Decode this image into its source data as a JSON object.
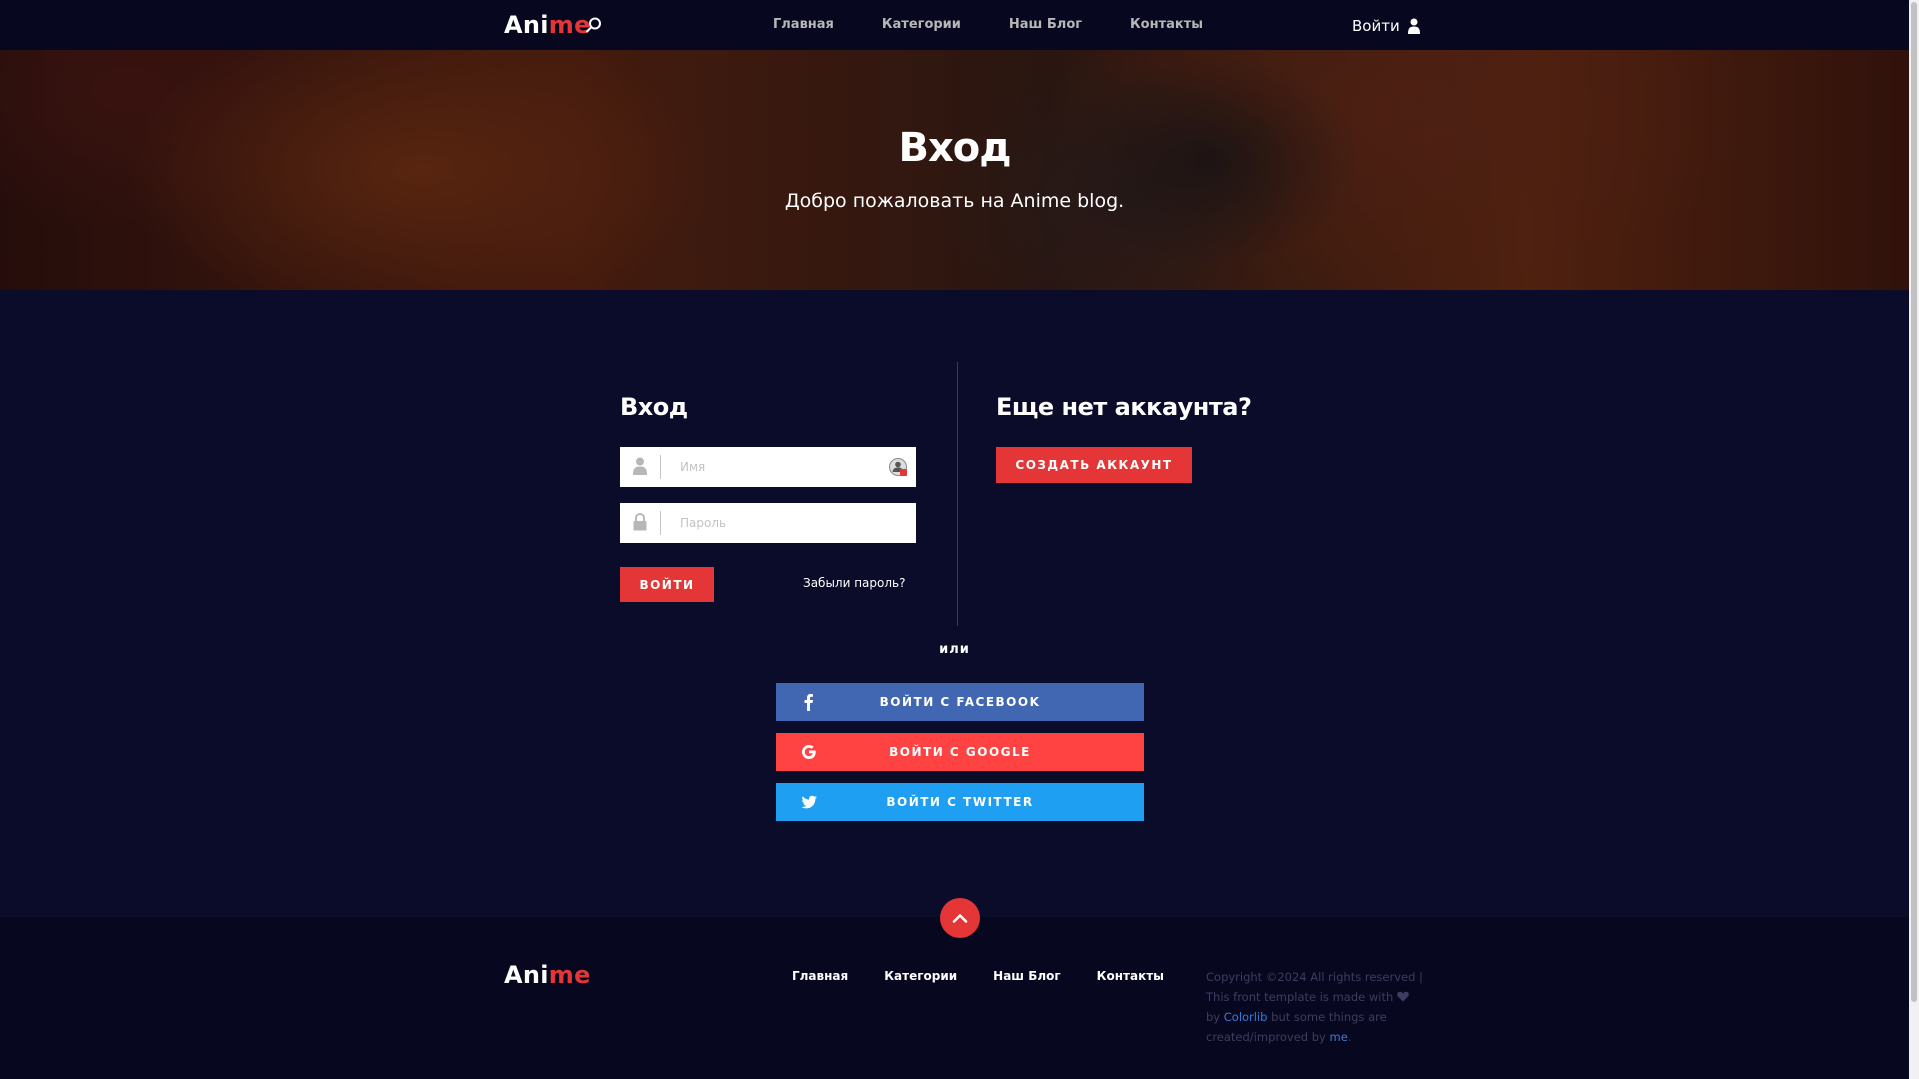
{
  "header": {
    "logo_part1": "Ani",
    "logo_part2": "me",
    "nav": [
      "Главная",
      "Категории",
      "Наш Блог",
      "Контакты"
    ],
    "login_label": "Войти"
  },
  "hero": {
    "title": "Вход",
    "subtitle": "Добро пожаловать на Anime blog."
  },
  "login": {
    "title": "Вход",
    "name_placeholder": "Имя",
    "password_placeholder": "Пароль",
    "submit_label": "Войти",
    "forgot_label": "Забыли пароль?"
  },
  "signup": {
    "title": "Еще нет аккаунта?",
    "create_label": "Создать аккаунт"
  },
  "or_label": "или",
  "social": {
    "facebook_label": "Войти с Facebook",
    "google_label": "Войти с Google",
    "twitter_label": "Войти с Twitter"
  },
  "footer": {
    "logo_part1": "Ani",
    "logo_part2": "me",
    "nav": [
      "Главная",
      "Категории",
      "Наш Блог",
      "Контакты"
    ],
    "copyright_text": "Copyright ©2024 All rights reserved | This front template is made with",
    "by_text": "by",
    "colorlib_link": "Colorlib",
    "middle_text": "but some things are created/improved by",
    "me_link": "me",
    "end_text": "."
  },
  "colors": {
    "accent": "#e53637",
    "background": "#0b0c2a",
    "facebook": "#4267b2",
    "google": "#ff4343",
    "twitter": "#1e9ff2"
  },
  "icons": {
    "search": "search-icon",
    "user": "user-icon",
    "lock": "lock-icon",
    "facebook": "facebook-icon",
    "google": "google-icon",
    "twitter": "twitter-icon",
    "heart": "heart-icon",
    "chevron_up": "chevron-up-icon"
  }
}
